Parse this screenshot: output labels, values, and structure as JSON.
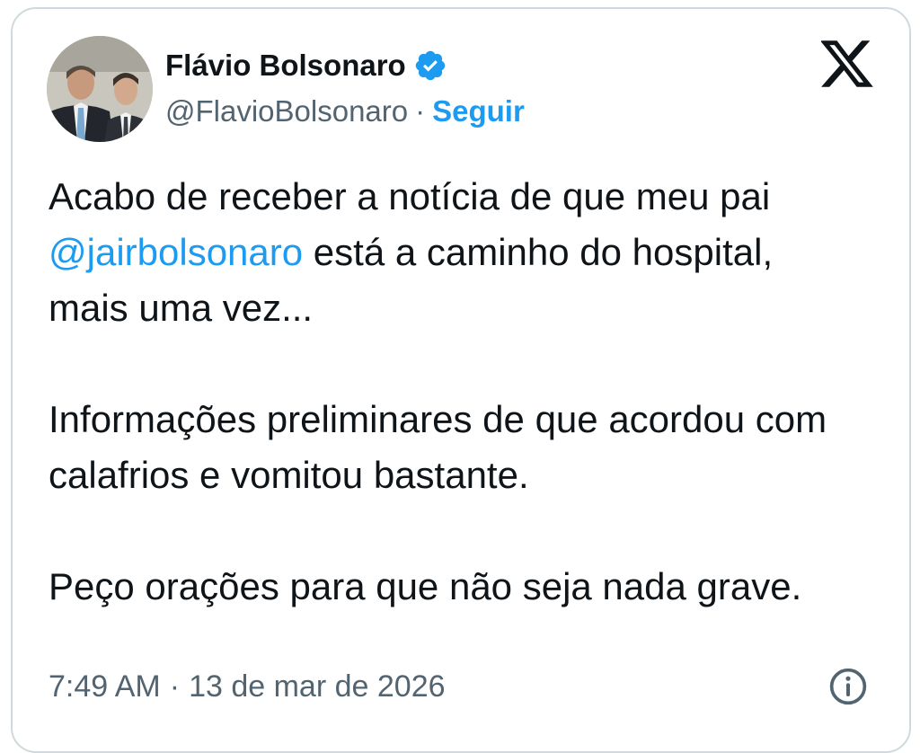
{
  "author": {
    "name": "Flávio Bolsonaro",
    "handle": "@FlavioBolsonaro",
    "separator": "·",
    "follow_label": "Seguir",
    "verified_icon": "verified-badge-icon"
  },
  "tweet": {
    "line1": "Acabo de receber a notícia de que meu pai",
    "mention": "@jairbolsonaro",
    "line2_rest": " está a caminho do hospital,",
    "line3": "mais uma vez...",
    "paragraph2": "Informações preliminares de que acordou com calafrios e vomitou bastante.",
    "paragraph3": "Peço orações para que não seja nada grave."
  },
  "meta": {
    "time": "7:49 AM",
    "separator": "·",
    "date": "13 de mar de 2026"
  },
  "icons": {
    "brand": "x-logo-icon",
    "info": "info-icon"
  },
  "colors": {
    "link": "#1d9bf0",
    "text": "#0f1419",
    "muted": "#536471",
    "border": "#cfd9de"
  }
}
